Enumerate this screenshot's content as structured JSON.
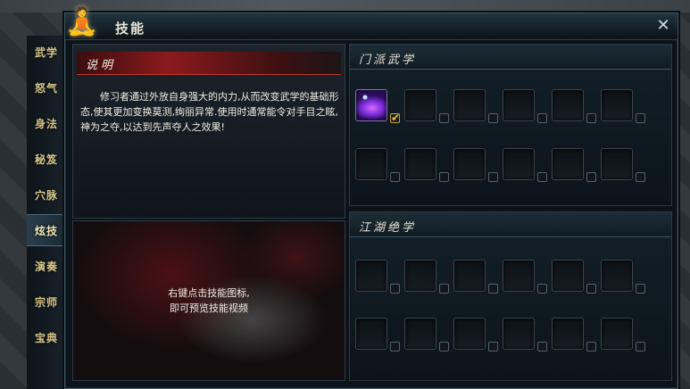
{
  "window": {
    "title": "技能",
    "emblem_icon": "meditating-figure-icon",
    "close_label": "✕"
  },
  "tabs": [
    {
      "label": "武学",
      "active": false
    },
    {
      "label": "怒气",
      "active": false
    },
    {
      "label": "身法",
      "active": false
    },
    {
      "label": "秘笈",
      "active": false
    },
    {
      "label": "穴脉",
      "active": false
    },
    {
      "label": "炫技",
      "active": true
    },
    {
      "label": "演奏",
      "active": false
    },
    {
      "label": "宗师",
      "active": false
    },
    {
      "label": "宝典",
      "active": false
    }
  ],
  "description": {
    "title": "说明",
    "text": "修习者通过外放自身强大的内力,从而改变武学的基础形态,使其更加变换莫测,绚丽异常.使用时通常能令对手目之眩,神为之夺,以达到先声夺人之效果!"
  },
  "video": {
    "hint_line1": "右键点击技能图标,",
    "hint_line2": "即可预览技能视频"
  },
  "sections": [
    {
      "title": "门派武学",
      "slots": [
        {
          "filled": true,
          "icon": "purple-energy-skill-icon",
          "checked": true
        },
        {
          "filled": false,
          "checked": false
        },
        {
          "filled": false,
          "checked": false
        },
        {
          "filled": false,
          "checked": false
        },
        {
          "filled": false,
          "checked": false
        },
        {
          "filled": false,
          "checked": false
        },
        {
          "filled": false,
          "checked": false
        },
        {
          "filled": false,
          "checked": false
        },
        {
          "filled": false,
          "checked": false
        },
        {
          "filled": false,
          "checked": false
        },
        {
          "filled": false,
          "checked": false
        },
        {
          "filled": false,
          "checked": false
        }
      ]
    },
    {
      "title": "江湖绝学",
      "slots": [
        {
          "filled": false,
          "checked": false
        },
        {
          "filled": false,
          "checked": false
        },
        {
          "filled": false,
          "checked": false
        },
        {
          "filled": false,
          "checked": false
        },
        {
          "filled": false,
          "checked": false
        },
        {
          "filled": false,
          "checked": false
        },
        {
          "filled": false,
          "checked": false
        },
        {
          "filled": false,
          "checked": false
        },
        {
          "filled": false,
          "checked": false
        },
        {
          "filled": false,
          "checked": false
        },
        {
          "filled": false,
          "checked": false
        },
        {
          "filled": false,
          "checked": false
        }
      ]
    }
  ],
  "colors": {
    "accent_red": "#8c1a1c",
    "tab_text": "#d9c68a",
    "check_mark": "#f2c24a",
    "skill_purple": "#7a2bd8"
  }
}
